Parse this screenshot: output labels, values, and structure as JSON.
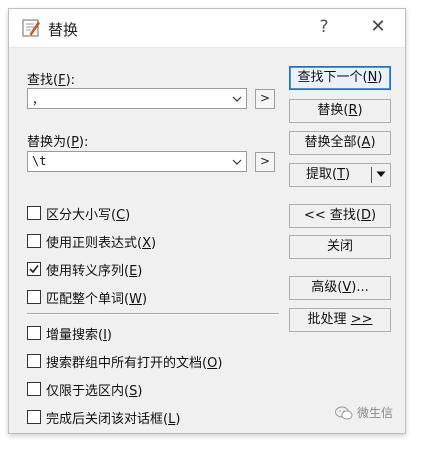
{
  "window": {
    "title": "替换",
    "help": "?",
    "close": "✕"
  },
  "find": {
    "label_text": "查找(",
    "label_mnemonic": "F",
    "label_suffix": "):",
    "value": "，"
  },
  "replace": {
    "label_text": "替换为(",
    "label_mnemonic": "P",
    "label_suffix": "):",
    "value": "\\t"
  },
  "small_button": ">",
  "options": [
    {
      "text": "区分大小写(",
      "mnemonic": "C",
      "suffix": ")",
      "checked": false
    },
    {
      "text": "使用正则表达式(",
      "mnemonic": "X",
      "suffix": ")",
      "checked": false
    },
    {
      "text": "使用转义序列(",
      "mnemonic": "E",
      "suffix": ")",
      "checked": true
    },
    {
      "text": "匹配整个单词(",
      "mnemonic": "W",
      "suffix": ")",
      "checked": false
    },
    {
      "text": "增量搜索(",
      "mnemonic": "I",
      "suffix": ")",
      "checked": false
    },
    {
      "text": "搜索群组中所有打开的文档(",
      "mnemonic": "O",
      "suffix": ")",
      "checked": false
    },
    {
      "text": "仅限于选区内(",
      "mnemonic": "S",
      "suffix": ")",
      "checked": false
    },
    {
      "text": "完成后关闭该对话框(",
      "mnemonic": "L",
      "suffix": ")",
      "checked": false
    }
  ],
  "buttons": {
    "find_next": {
      "text": "查找下一个(",
      "mnemonic": "N",
      "suffix": ")"
    },
    "replace": {
      "text": "替换(",
      "mnemonic": "R",
      "suffix": ")"
    },
    "replace_all": {
      "text": "替换全部(",
      "mnemonic": "A",
      "suffix": ")"
    },
    "extract": {
      "text": "提取(",
      "mnemonic": "T",
      "suffix": ")"
    },
    "find_prev": {
      "text": "<< 查找(",
      "mnemonic": "D",
      "suffix": ")"
    },
    "close": {
      "text": "关闭"
    },
    "advanced": {
      "text": "高级(",
      "mnemonic": "V",
      "suffix": ")..."
    },
    "batch": {
      "text": "批处理 ",
      "mnemonic": ">>",
      "suffix": ""
    }
  },
  "watermark": "微生信",
  "colors": {
    "accent": "#1f6fc4",
    "dialog_bg": "#f0f0f0"
  }
}
